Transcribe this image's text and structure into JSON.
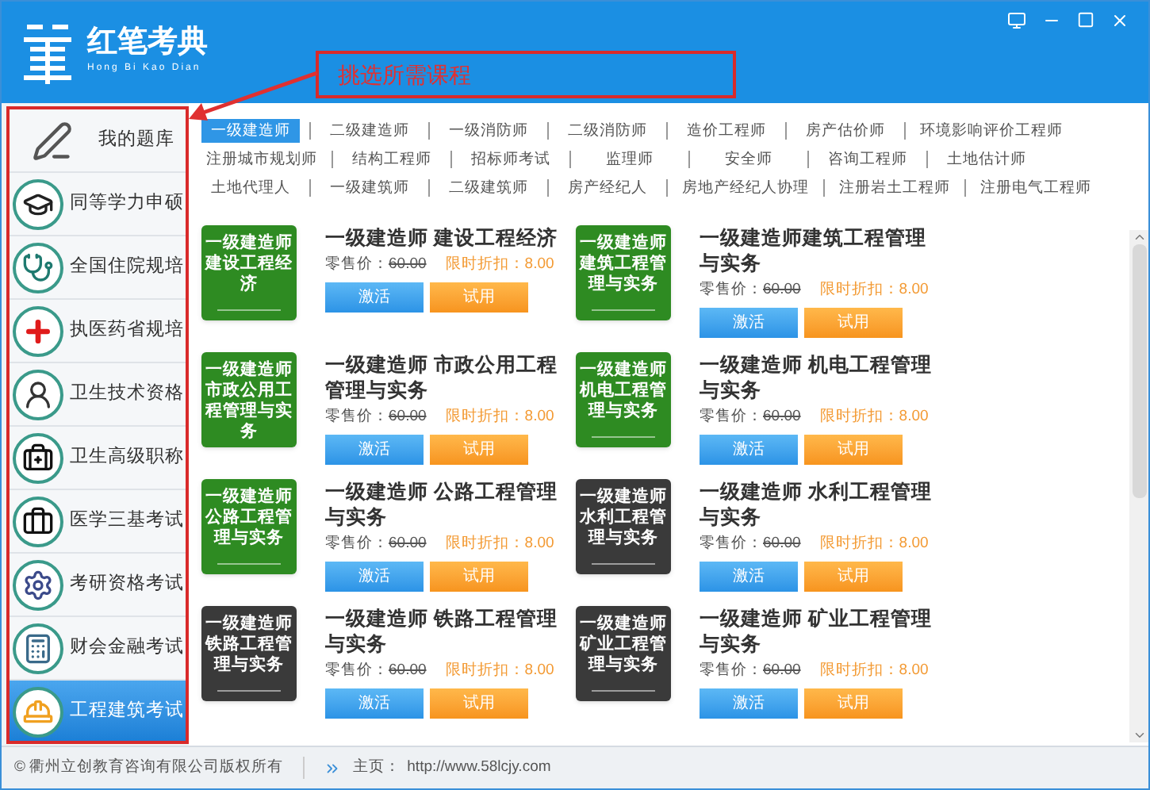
{
  "window": {
    "title": "红笔考典",
    "subtitle": "Hong Bi Kao Dian"
  },
  "annotation": {
    "text": "挑选所需课程"
  },
  "sidebar": {
    "items": [
      {
        "label": "我的题库",
        "kind": "pen",
        "selected": false
      },
      {
        "label": "同等学力申硕",
        "kind": "cap",
        "selected": false
      },
      {
        "label": "全国住院规培",
        "kind": "doctor",
        "selected": false
      },
      {
        "label": "执医药省规培",
        "kind": "cross",
        "selected": false
      },
      {
        "label": "卫生技术资格",
        "kind": "nurse",
        "selected": false
      },
      {
        "label": "卫生高级职称",
        "kind": "kit",
        "selected": false
      },
      {
        "label": "医学三基考试",
        "kind": "bag",
        "selected": false
      },
      {
        "label": "考研资格考试",
        "kind": "gear",
        "selected": false
      },
      {
        "label": "财会金融考试",
        "kind": "calc",
        "selected": false
      },
      {
        "label": "工程建筑考试",
        "kind": "helmet",
        "selected": true
      }
    ]
  },
  "categories": {
    "rows": [
      [
        {
          "label": "一级建造师",
          "selected": true
        },
        {
          "label": "二级建造师",
          "selected": false
        },
        {
          "label": "一级消防师",
          "selected": false
        },
        {
          "label": "二级消防师",
          "selected": false
        },
        {
          "label": "造价工程师",
          "selected": false
        },
        {
          "label": "房产估价师",
          "selected": false
        },
        {
          "label": "环境影响评价工程师",
          "selected": false
        }
      ],
      [
        {
          "label": "注册城市规划师",
          "selected": false
        },
        {
          "label": "结构工程师",
          "selected": false
        },
        {
          "label": "招标师考试",
          "selected": false
        },
        {
          "label": "监理师",
          "selected": false
        },
        {
          "label": "安全师",
          "selected": false
        },
        {
          "label": "咨询工程师",
          "selected": false
        },
        {
          "label": "土地估计师",
          "selected": false
        }
      ],
      [
        {
          "label": "土地代理人",
          "selected": false
        },
        {
          "label": "一级建筑师",
          "selected": false
        },
        {
          "label": "二级建筑师",
          "selected": false
        },
        {
          "label": "房产经纪人",
          "selected": false
        },
        {
          "label": "房地产经纪人协理",
          "selected": false
        },
        {
          "label": "注册岩土工程师",
          "selected": false
        },
        {
          "label": "注册电气工程师",
          "selected": false
        }
      ]
    ]
  },
  "courses": [
    {
      "thumb_text": "一级建造师建设工程经济",
      "color": "#2e8b22",
      "title": "一级建造师 建设工程经济",
      "price_label": "零售价：",
      "price": "60.00",
      "discount_label": "限时折扣：",
      "discount": "8.00",
      "buttons": [
        "激活",
        "试用"
      ]
    },
    {
      "thumb_text": "一级建造师建筑工程管理与实务",
      "color": "#2e8b22",
      "title": "一级建造师建筑工程管理与实务",
      "price_label": "零售价：",
      "price": "60.00",
      "discount_label": "限时折扣：",
      "discount": "8.00",
      "buttons": [
        "激活",
        "试用"
      ]
    },
    {
      "thumb_text": "一级建造师市政公用工程管理与实务",
      "color": "#2e8b22",
      "title": "一级建造师 市政公用工程管理与实务",
      "price_label": "零售价：",
      "price": "60.00",
      "discount_label": "限时折扣：",
      "discount": "8.00",
      "buttons": [
        "激活",
        "试用"
      ]
    },
    {
      "thumb_text": "一级建造师机电工程管理与实务",
      "color": "#2e8b22",
      "title": "一级建造师 机电工程管理与实务",
      "price_label": "零售价：",
      "price": "60.00",
      "discount_label": "限时折扣：",
      "discount": "8.00",
      "buttons": [
        "激活",
        "试用"
      ]
    },
    {
      "thumb_text": "一级建造师公路工程管理与实务",
      "color": "#2e8b22",
      "title": "一级建造师 公路工程管理与实务",
      "price_label": "零售价：",
      "price": "60.00",
      "discount_label": "限时折扣：",
      "discount": "8.00",
      "buttons": [
        "激活",
        "试用"
      ]
    },
    {
      "thumb_text": "一级建造师水利工程管理与实务",
      "color": "#3a3a3a",
      "title": "一级建造师 水利工程管理与实务",
      "price_label": "零售价：",
      "price": "60.00",
      "discount_label": "限时折扣：",
      "discount": "8.00",
      "buttons": [
        "激活",
        "试用"
      ]
    },
    {
      "thumb_text": "一级建造师铁路工程管理与实务",
      "color": "#3a3a3a",
      "title": "一级建造师 铁路工程管理与实务",
      "price_label": "零售价：",
      "price": "60.00",
      "discount_label": "限时折扣：",
      "discount": "8.00",
      "buttons": [
        "激活",
        "试用"
      ]
    },
    {
      "thumb_text": "一级建造师矿业工程管理与实务",
      "color": "#3a3a3a",
      "title": "一级建造师 矿业工程管理与实务",
      "price_label": "零售价：",
      "price": "60.00",
      "discount_label": "限时折扣：",
      "discount": "8.00",
      "buttons": [
        "激活",
        "试用"
      ]
    }
  ],
  "footer": {
    "copyright": "© 衢州立创教育咨询有限公司版权所有",
    "home_label": "主页：",
    "url": "http://www.58lcjy.com"
  }
}
